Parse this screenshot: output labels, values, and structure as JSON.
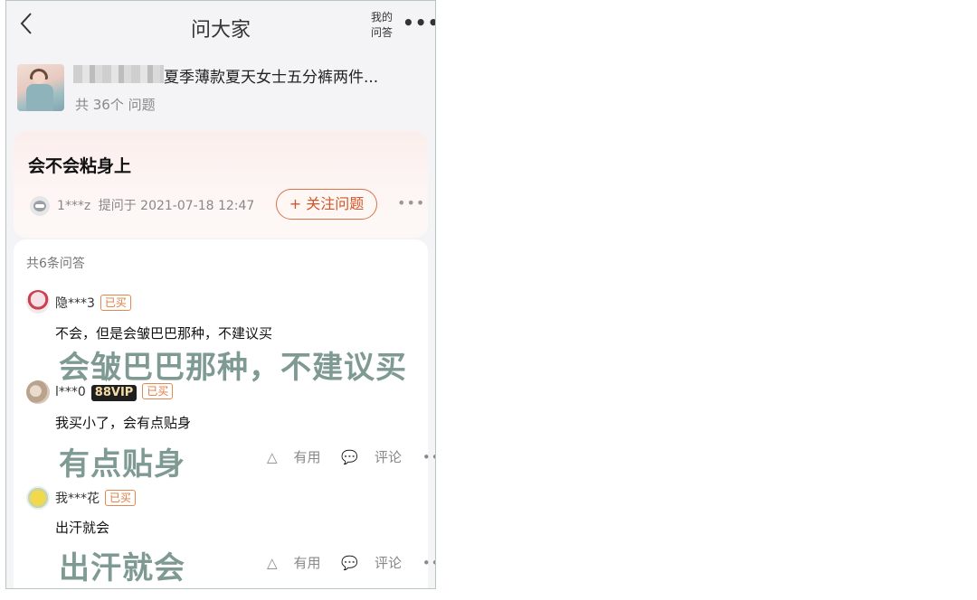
{
  "header": {
    "title": "问大家",
    "my_qa": "我的问答",
    "my_qa_line1": "我的",
    "my_qa_line2": "问答",
    "more": "•••"
  },
  "product": {
    "title": "夏季薄款夏天女士五分裤两件...",
    "question_count": "共 36个 问题"
  },
  "question": {
    "text": "会不会粘身上",
    "user": "1***z",
    "asked_at": "提问于 2021-07-18 12:47",
    "follow_label": "+ 关注问题",
    "more": "•••"
  },
  "answers_block": {
    "count_label": "共6条问答",
    "answers": [
      {
        "user": "隐***3",
        "badge": "已买",
        "vip": "",
        "text": "不会，但是会皱巴巴那种，不建议买"
      },
      {
        "user": "l***0",
        "badge": "已买",
        "vip": "88VIP",
        "text": "我买小了，会有点贴身",
        "useful": "有用",
        "comment": "评论",
        "more": "•••"
      },
      {
        "user": "我***花",
        "badge": "已买",
        "vip": "",
        "text": "出汗就会",
        "useful": "有用",
        "comment": "评论",
        "more": "•••"
      }
    ]
  },
  "overlays": [
    "会皱巴巴那种，不建议买",
    "有点贴身",
    "出汗就会"
  ],
  "colors": {
    "accent": "#d2562a",
    "overlay_text": "#7e9a93",
    "frame_border": "#b9c7bf"
  }
}
